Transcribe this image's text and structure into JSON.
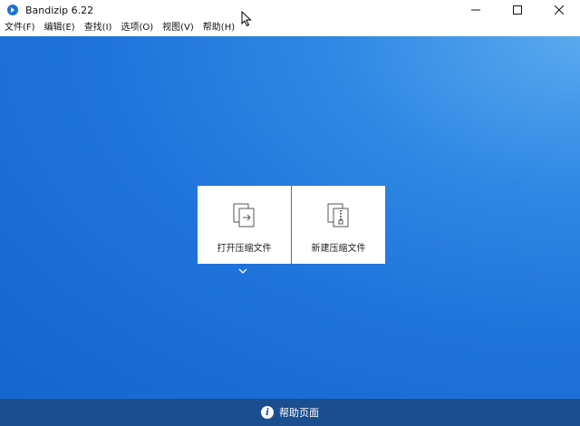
{
  "window": {
    "title": "Bandizip 6.22"
  },
  "menu": [
    {
      "label": "文件(F)"
    },
    {
      "label": "编辑(E)"
    },
    {
      "label": "查找(I)"
    },
    {
      "label": "选项(O)"
    },
    {
      "label": "视图(V)"
    },
    {
      "label": "帮助(H)"
    }
  ],
  "actions": {
    "open_archive": "打开压缩文件",
    "new_archive": "新建压缩文件"
  },
  "footer": {
    "help_label": "帮助页面"
  },
  "colors": {
    "content_bg": "#1e73da",
    "bottom_bar": "#1a4e8f",
    "card_bg": "#ffffff"
  }
}
